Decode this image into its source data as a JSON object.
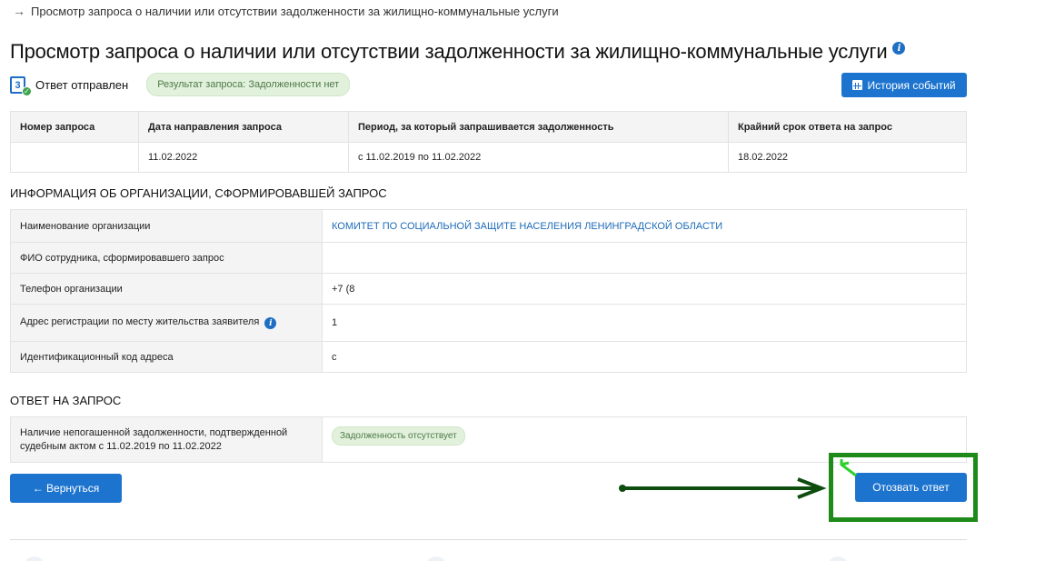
{
  "breadcrumb": {
    "arrow": "→",
    "text": "Просмотр запроса о наличии или отсутствии задолженности за жилищно-коммунальные услуги"
  },
  "page": {
    "title": "Просмотр запроса о наличии или отсутствии задолженности за жилищно-коммунальные услуги",
    "info_icon": "i"
  },
  "status": {
    "icon_number": "3",
    "sent_label": "Ответ отправлен",
    "result_badge": "Результат запроса: Задолженности нет"
  },
  "history_button": {
    "label": "История событий",
    "icon": "calendar-icon"
  },
  "request_table": {
    "headers": [
      "Номер запроса",
      "Дата направления запроса",
      "Период, за который запрашивается задолженность",
      "Крайний срок ответа на запрос"
    ],
    "row": [
      "",
      "11.02.2022",
      "с 11.02.2019 по 11.02.2022",
      "18.02.2022"
    ]
  },
  "org_section": {
    "title": "ИНФОРМАЦИЯ ОБ ОРГАНИЗАЦИИ, СФОРМИРОВАВШЕЙ ЗАПРОС",
    "rows": [
      {
        "key": "Наименование организации",
        "value": "КОМИТЕТ ПО СОЦИАЛЬНОЙ ЗАЩИТЕ НАСЕЛЕНИЯ ЛЕНИНГРАДСКОЙ ОБЛАСТИ"
      },
      {
        "key": "ФИО сотрудника, сформировавшего запрос",
        "value": ""
      },
      {
        "key": "Телефон организации",
        "value": "+7 (8"
      },
      {
        "key": "Адрес регистрации по месту жительства заявителя",
        "value": "1"
      },
      {
        "key": "Идентификационный код адреса",
        "value": "c"
      }
    ]
  },
  "answer_section": {
    "title": "ОТВЕТ НА ЗАПРОС",
    "key_line1": "Наличие непогашенной задолженности, подтвержденной",
    "key_line2": "судебным актом с 11.02.2019 по 11.02.2022",
    "badge": "Задолженность отсутствует"
  },
  "buttons": {
    "back": "← Вернуться",
    "revoke": "Отозвать ответ"
  },
  "colors": {
    "primary": "#1d74cf",
    "badge_bg": "#e2f1dc",
    "annotation_green": "#1e8a1a",
    "arrow_dark_green": "#0f4d0f"
  }
}
